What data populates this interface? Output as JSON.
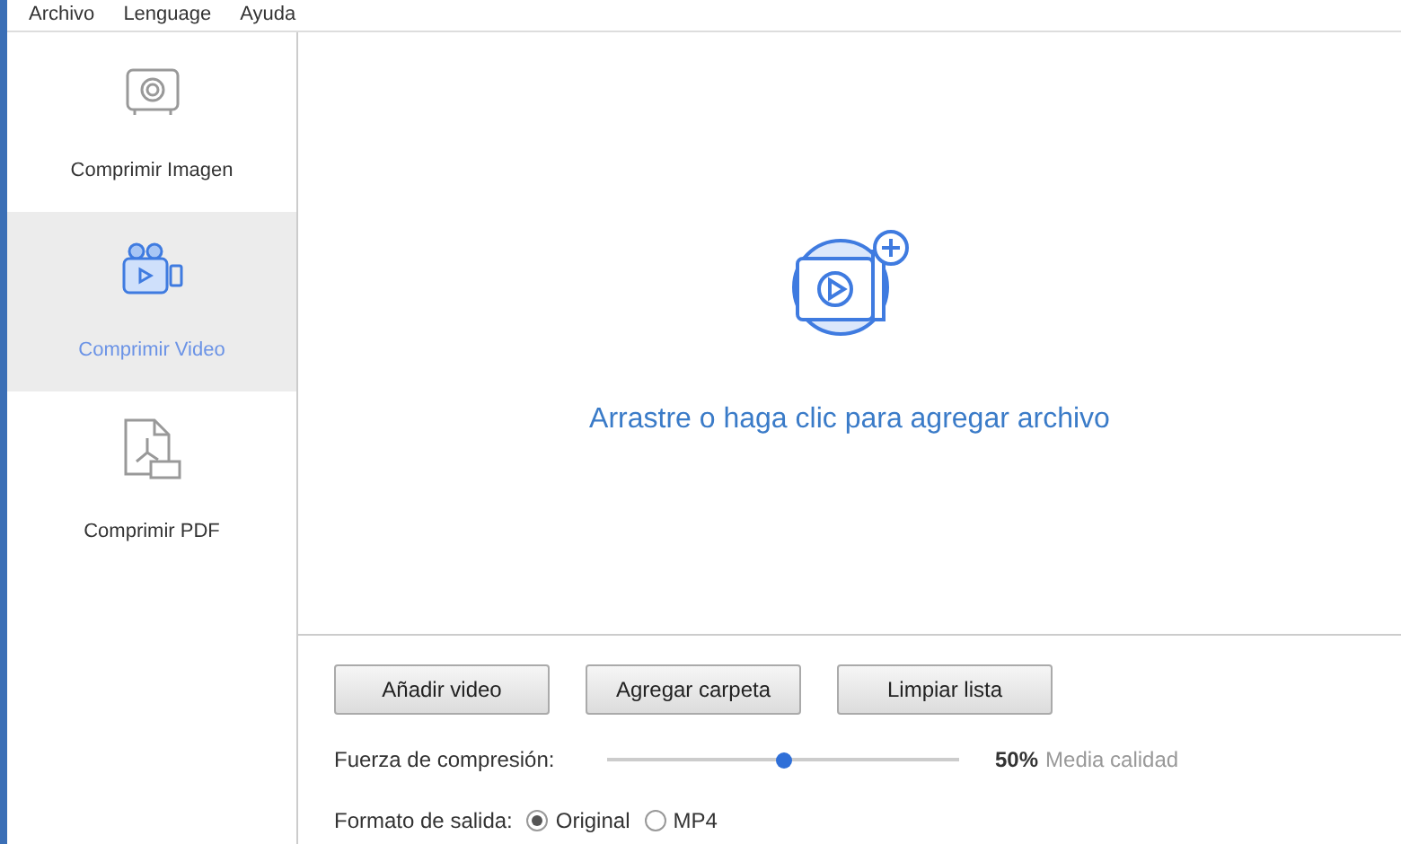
{
  "menu": [
    "Archivo",
    "Lenguage",
    "Ayuda"
  ],
  "sidebar": {
    "items": [
      {
        "kind": "image",
        "label": "Comprimir Imagen",
        "selected": false
      },
      {
        "kind": "video",
        "label": "Comprimir Video",
        "selected": true
      },
      {
        "kind": "pdf",
        "label": "Comprimir PDF",
        "selected": false
      }
    ]
  },
  "dropzone": {
    "text": "Arrastre o haga clic para agregar archivo"
  },
  "buttons": [
    "Añadir video",
    "Agregar carpeta",
    "Limpiar lista"
  ],
  "compression": {
    "label": "Fuerza de compresión:",
    "level": 0.5,
    "reading": "50%",
    "quality": "Media calidad"
  },
  "output_format": {
    "label": "Formato de salida:",
    "options": [
      {
        "label": "Original",
        "selected": true
      },
      {
        "label": "MP4",
        "selected": false
      }
    ]
  }
}
